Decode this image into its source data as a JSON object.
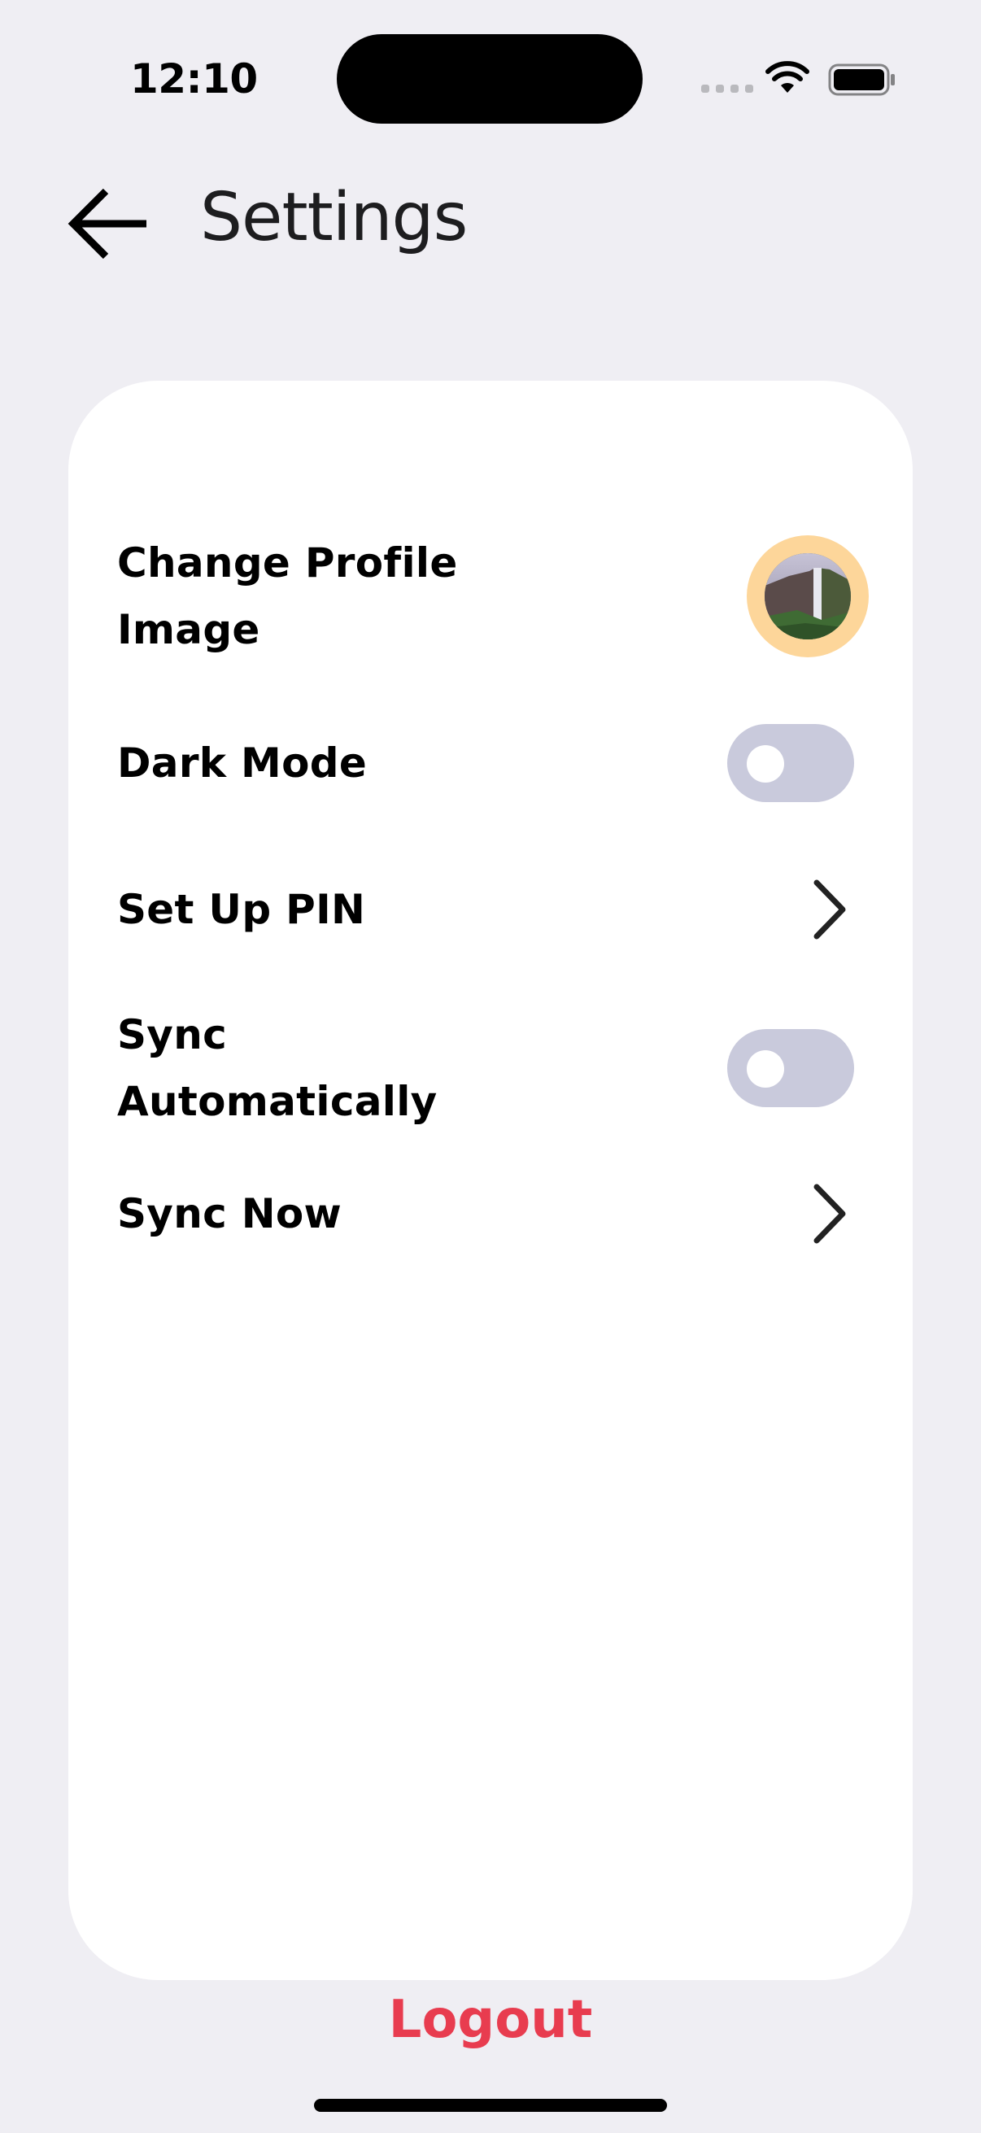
{
  "status_bar": {
    "time": "12:10"
  },
  "header": {
    "title": "Settings",
    "back_icon": "arrow-left-icon"
  },
  "settings": {
    "change_profile_image": {
      "label": "Change Profile\nImage",
      "control": "avatar"
    },
    "dark_mode": {
      "label": "Dark Mode",
      "control": "toggle",
      "enabled": false
    },
    "set_up_pin": {
      "label": "Set Up PIN",
      "control": "chevron-right-icon"
    },
    "sync_automatically": {
      "label": "Sync\nAutomatically",
      "control": "toggle",
      "enabled": false
    },
    "sync_now": {
      "label": "Sync Now",
      "control": "chevron-right-icon"
    }
  },
  "logout_label": "Logout",
  "colors": {
    "background": "#efeef3",
    "card": "#ffffff",
    "toggle_off": "#c9cadc",
    "avatar_ring": "#fdd69a",
    "logout": "#e83c4f"
  }
}
